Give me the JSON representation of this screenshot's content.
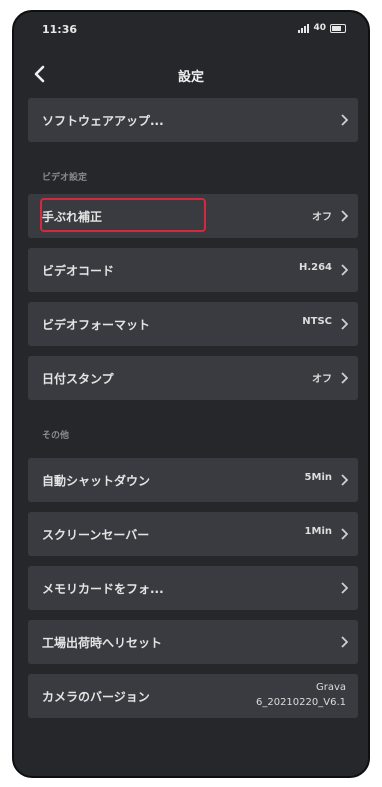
{
  "status": {
    "time": "11:36",
    "battery": "40"
  },
  "header": {
    "title": "設定"
  },
  "top_rows": [
    {
      "label": "ソフトウェアアップ...",
      "value": ""
    }
  ],
  "video_section": {
    "label": "ビデオ設定",
    "rows": [
      {
        "label": "手ぶれ補正",
        "value": "オフ"
      },
      {
        "label": "ビデオコード",
        "value": "H.264"
      },
      {
        "label": "ビデオフォーマット",
        "value": "NTSC"
      },
      {
        "label": "日付スタンプ",
        "value": "オフ"
      }
    ]
  },
  "other_section": {
    "label": "その他",
    "rows": [
      {
        "label": "自動シャットダウン",
        "value": "5Min"
      },
      {
        "label": "スクリーンセーバー",
        "value": "1Min"
      },
      {
        "label": "メモリカードをフォ...",
        "value": ""
      },
      {
        "label": "工場出荷時へリセット",
        "value": ""
      },
      {
        "label": "カメラのバージョン",
        "value_line1": "Grava",
        "value_line2": "6_20210220_V6.1"
      }
    ]
  },
  "colors": {
    "background": "#26272b",
    "row": "#3a3b40",
    "highlight": "#d3283e"
  },
  "icons": {
    "back": "chevron-left-icon",
    "row_arrow": "chevron-right-icon"
  }
}
